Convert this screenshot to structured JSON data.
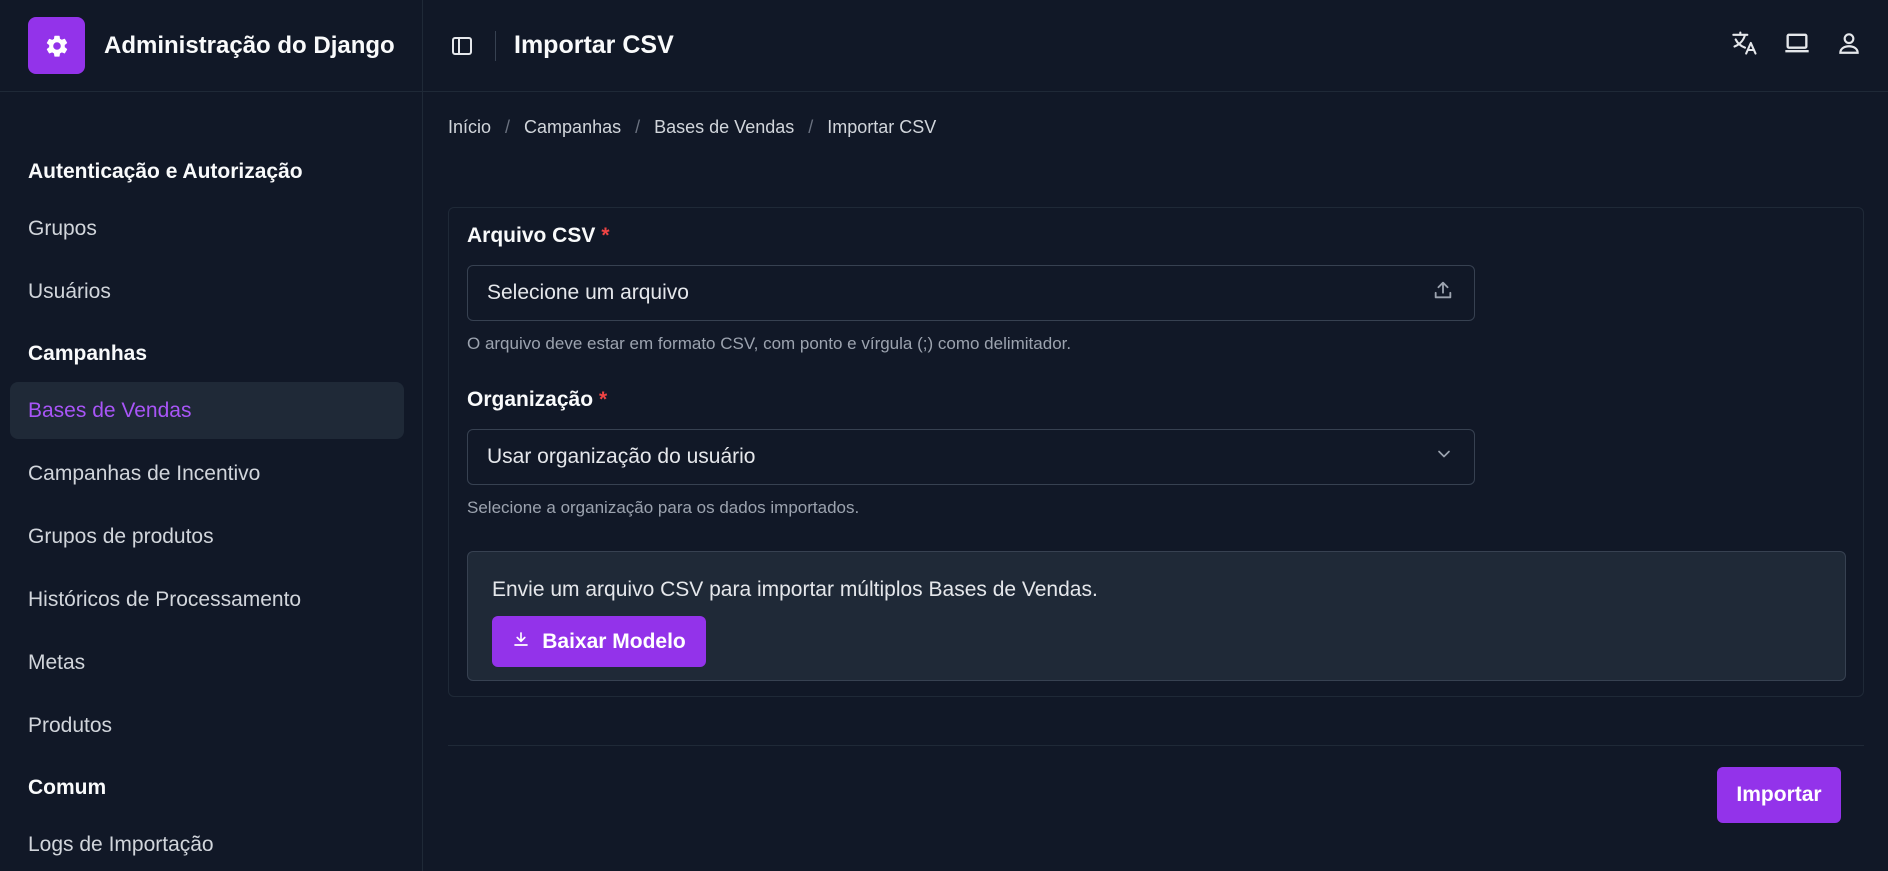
{
  "brand": {
    "title": "Administração do Django"
  },
  "header": {
    "title": "Importar CSV"
  },
  "breadcrumb": [
    "Início",
    "Campanhas",
    "Bases de Vendas",
    "Importar CSV"
  ],
  "sidebar": {
    "sections": [
      {
        "title": "Autenticação e Autorização",
        "items": [
          "Grupos",
          "Usuários"
        ]
      },
      {
        "title": "Campanhas",
        "items": [
          "Bases de Vendas",
          "Campanhas de Incentivo",
          "Grupos de produtos",
          "Históricos de Processamento",
          "Metas",
          "Produtos"
        ]
      },
      {
        "title": "Comum",
        "items": [
          "Logs de Importação"
        ]
      }
    ],
    "active": "Bases de Vendas"
  },
  "form": {
    "file_label": "Arquivo CSV",
    "file_placeholder": "Selecione um arquivo",
    "file_help": "O arquivo deve estar em formato CSV, com ponto e vírgula (;) como delimitador.",
    "org_label": "Organização",
    "org_value": "Usar organização do usuário",
    "org_help": "Selecione a organização para os dados importados.",
    "required_mark": "*",
    "info_text": "Envie um arquivo CSV para importar múltiplos Bases de Vendas.",
    "download_label": "Baixar Modelo",
    "submit_label": "Importar"
  },
  "colors": {
    "accent": "#9333ea",
    "accent_text": "#a855f7",
    "background": "#111827",
    "required": "#ef4444"
  },
  "icons": [
    "gear-icon",
    "sidebar-toggle-icon",
    "translate-icon",
    "laptop-icon",
    "user-icon",
    "upload-icon",
    "chevron-down-icon",
    "download-icon"
  ]
}
